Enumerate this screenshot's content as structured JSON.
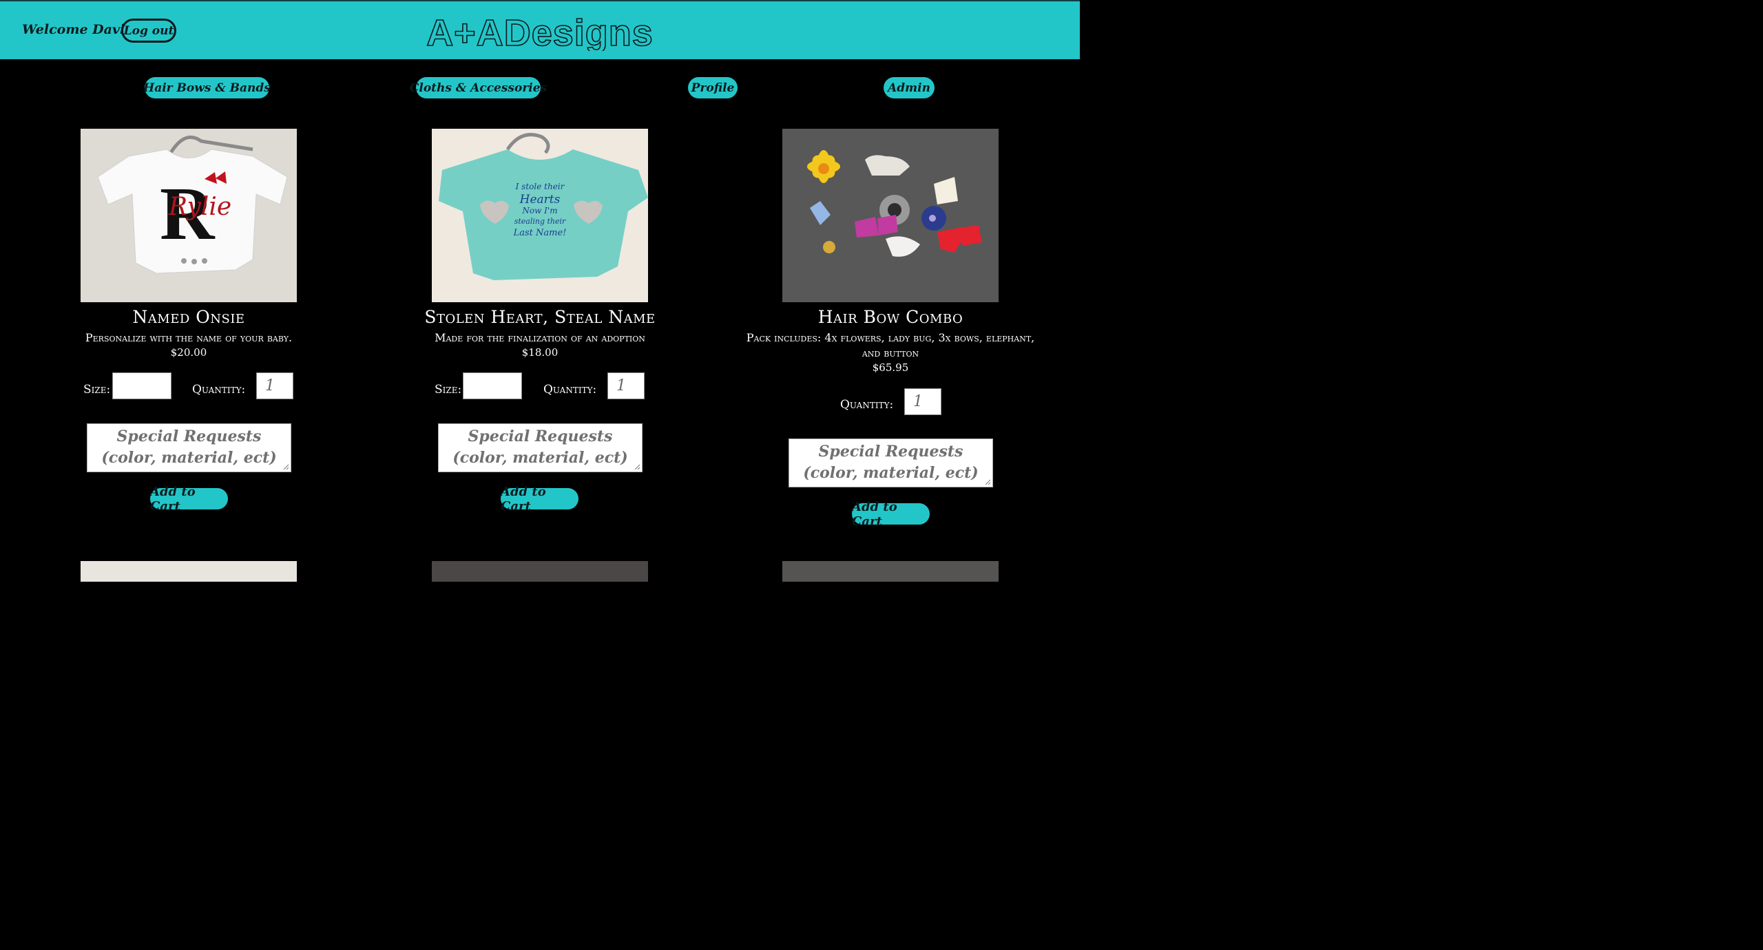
{
  "header": {
    "welcome": "Welcome David",
    "logout_label": "Log out",
    "logo_text": "A+ADesigns"
  },
  "nav": [
    {
      "label": "Hair Bows & Bands"
    },
    {
      "label": "Cloths & Accessories"
    },
    {
      "label": "Profile"
    },
    {
      "label": "Admin"
    }
  ],
  "products": [
    {
      "name": "Named Onsie",
      "description": "Personalize with the name of your baby.",
      "price": "$20.00",
      "size_label": "Size:",
      "size_value": "",
      "quantity_label": "Quantity:",
      "quantity_value": "1",
      "requests_placeholder": "Special Requests (color, material, ect)",
      "add_label": "Add to Cart"
    },
    {
      "name": "Stolen Heart, Steal Name",
      "description": "Made for the finalization of an adoption",
      "price": "$18.00",
      "size_label": "Size:",
      "size_value": "",
      "quantity_label": "Quantity:",
      "quantity_value": "1",
      "requests_placeholder": "Special Requests (color, material, ect)",
      "add_label": "Add to Cart"
    },
    {
      "name": "Hair Bow Combo",
      "description": "Pack includes: 4x flowers, lady bug, 3x bows, elephant, and button",
      "price": "$65.95",
      "quantity_label": "Quantity:",
      "quantity_value": "1",
      "requests_placeholder": "Special Requests (color, material, ect)",
      "add_label": "Add to Cart"
    }
  ],
  "image_text": {
    "onesie_letter": "R",
    "onesie_name": "Rylie",
    "shirt_lines": [
      "I stole their",
      "Hearts",
      "Now I'm",
      "stealing their",
      "Last Name!"
    ]
  },
  "colors": {
    "accent": "#23c6c8",
    "background": "#000000",
    "button_text": "#0b1b1e"
  }
}
